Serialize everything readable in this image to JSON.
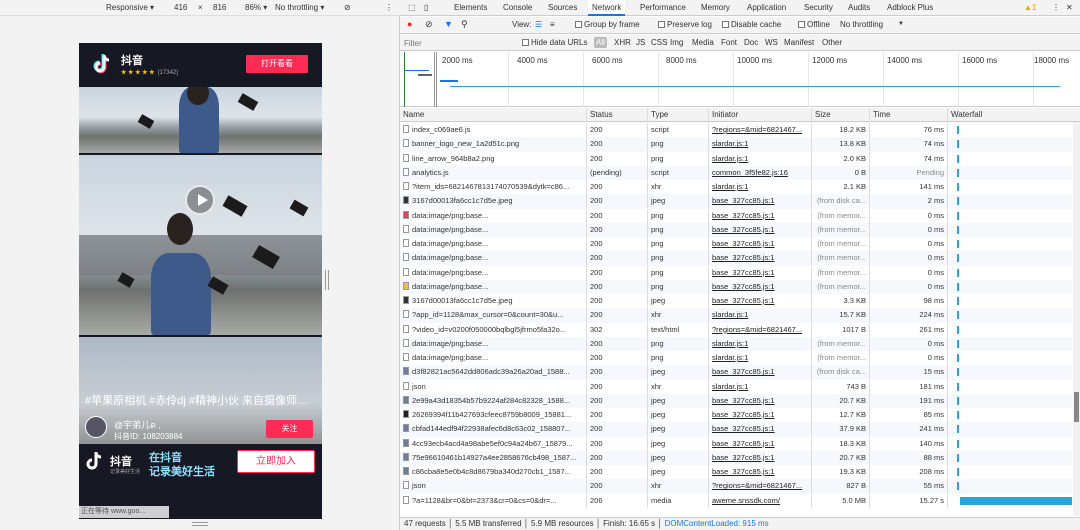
{
  "device_bar": {
    "device": "Responsive ▾",
    "width": "416",
    "x": "×",
    "height": "816",
    "zoom": "86% ▾",
    "throttle": "No throttling ▾",
    "more": "⋮"
  },
  "phone": {
    "app_name": "抖音",
    "rating_stars": "★ ★ ★ ★ ★",
    "rating_count": "(17342)",
    "open_button": "打开看看",
    "caption": "#苹果原相机 #赤伶dj #精神小伙 来自摄像师…",
    "username": "@宇弟儿ด ,",
    "user_id": "抖音ID: 108203884",
    "follow_button": "关注",
    "banner_name": "抖音",
    "banner_sub": "记录美好生活",
    "banner_slogan_1": "在抖音",
    "banner_slogan_2": "记录美好生活",
    "join_button": "立即加入",
    "status_text": "正在等待 www.goo..."
  },
  "devtools": {
    "tabs": [
      "Elements",
      "Console",
      "Sources",
      "Network",
      "Performance",
      "Memory",
      "Application",
      "Security",
      "Audits",
      "Adblock Plus"
    ],
    "active_tab": "Network",
    "warning_count": "▲1",
    "more": "⋮",
    "close": "✕",
    "toolbar": {
      "view_label": "View:",
      "group_by_frame": "Group by frame",
      "preserve_log": "Preserve log",
      "disable_cache": "Disable cache",
      "offline": "Offline",
      "throttling": "No throttling",
      "throttling_arrow": "▼"
    },
    "filter": {
      "placeholder": "Filter",
      "hide_data_urls": "Hide data URLs",
      "types": [
        "All",
        "XHR",
        "JS",
        "CSS",
        "Img",
        "Media",
        "Font",
        "Doc",
        "WS",
        "Manifest",
        "Other"
      ]
    },
    "overview_ticks": [
      "2000 ms",
      "4000 ms",
      "6000 ms",
      "8000 ms",
      "10000 ms",
      "12000 ms",
      "14000 ms",
      "16000 ms",
      "18000 ms"
    ],
    "columns": [
      "Name",
      "Status",
      "Type",
      "Initiator",
      "Size",
      "Time",
      "Waterfall"
    ],
    "rows": [
      {
        "name": "index_c069ae6.js",
        "status": "200",
        "type": "script",
        "initiator": "?regions=&mid=6821467...",
        "size": "18.2 KB",
        "time": "76 ms",
        "icon": "#fff"
      },
      {
        "name": "banner_logo_new_1a2d51c.png",
        "status": "200",
        "type": "png",
        "initiator": "slardar.js:1",
        "size": "13.8 KB",
        "time": "74 ms",
        "icon": "#fff"
      },
      {
        "name": "line_arrow_964b8a2.png",
        "status": "200",
        "type": "png",
        "initiator": "slardar.js:1",
        "size": "2.0 KB",
        "time": "74 ms",
        "icon": "#fff"
      },
      {
        "name": "analytics.js",
        "status": "(pending)",
        "type": "script",
        "initiator": "common_3f5fe82.js:16",
        "size": "0 B",
        "time": "Pending",
        "icon": "#fff"
      },
      {
        "name": "?item_ids=6821467813174070539&dytk=c86...",
        "status": "200",
        "type": "xhr",
        "initiator": "slardar.js:1",
        "size": "2.1 KB",
        "time": "141 ms",
        "icon": "#fff"
      },
      {
        "name": "3167d00013fa6cc1c7d5e.jpeg",
        "status": "200",
        "type": "jpeg",
        "initiator": "base_327cc85.js:1",
        "size": "(from disk ca...",
        "time": "2 ms",
        "icon": "#333"
      },
      {
        "name": "data:image/png;base...",
        "status": "200",
        "type": "png",
        "initiator": "base_327cc85.js:1",
        "size": "(from memor...",
        "time": "0 ms",
        "icon": "#e0445a"
      },
      {
        "name": "data:image/png;base...",
        "status": "200",
        "type": "png",
        "initiator": "base_327cc85.js:1",
        "size": "(from memor...",
        "time": "0 ms",
        "icon": "#fff"
      },
      {
        "name": "data:image/png;base...",
        "status": "200",
        "type": "png",
        "initiator": "base_327cc85.js:1",
        "size": "(from memor...",
        "time": "0 ms",
        "icon": "#fff"
      },
      {
        "name": "data:image/png;base...",
        "status": "200",
        "type": "png",
        "initiator": "base_327cc85.js:1",
        "size": "(from memor...",
        "time": "0 ms",
        "icon": "#fff"
      },
      {
        "name": "data:image/png;base...",
        "status": "200",
        "type": "png",
        "initiator": "base_327cc85.js:1",
        "size": "(from memor...",
        "time": "0 ms",
        "icon": "#fff"
      },
      {
        "name": "data:image/png;base...",
        "status": "200",
        "type": "png",
        "initiator": "base_327cc85.js:1",
        "size": "(from memor...",
        "time": "0 ms",
        "icon": "#f0c040"
      },
      {
        "name": "3167d00013fa6cc1c7d5e.jpeg",
        "status": "200",
        "type": "jpeg",
        "initiator": "base_327cc85.js:1",
        "size": "3.3 KB",
        "time": "98 ms",
        "icon": "#333"
      },
      {
        "name": "?app_id=1128&max_cursor=0&count=30&u...",
        "status": "200",
        "type": "xhr",
        "initiator": "slardar.js:1",
        "size": "15.7 KB",
        "time": "224 ms",
        "icon": "#fff"
      },
      {
        "name": "?video_id=v0200f050000bqlbgl5jfrmo5fa32o...",
        "status": "302",
        "type": "text/html",
        "initiator": "?regions=&mid=6821467...",
        "size": "1017 B",
        "time": "261 ms",
        "icon": "#fff"
      },
      {
        "name": "data:image/png;base...",
        "status": "200",
        "type": "png",
        "initiator": "slardar.js:1",
        "size": "(from memor...",
        "time": "0 ms",
        "icon": "#fff"
      },
      {
        "name": "data:image/png;base...",
        "status": "200",
        "type": "png",
        "initiator": "slardar.js:1",
        "size": "(from memor...",
        "time": "0 ms",
        "icon": "#fff"
      },
      {
        "name": "d3f82821ac5642dd806adc39a26a20ad_1588...",
        "status": "200",
        "type": "jpeg",
        "initiator": "base_327cc85.js:1",
        "size": "(from disk ca...",
        "time": "15 ms",
        "icon": "#6a7fa0"
      },
      {
        "name": "json",
        "status": "200",
        "type": "xhr",
        "initiator": "slardar.js:1",
        "size": "743 B",
        "time": "181 ms",
        "icon": "#fff"
      },
      {
        "name": "2e99a43d18354b57b9224af284c82328_1588...",
        "status": "200",
        "type": "jpeg",
        "initiator": "base_327cc85.js:1",
        "size": "20.7 KB",
        "time": "191 ms",
        "icon": "#6a7fa0"
      },
      {
        "name": "26269394f11b427693cfeec8759b8009_15881...",
        "status": "200",
        "type": "jpeg",
        "initiator": "base_327cc85.js:1",
        "size": "12.7 KB",
        "time": "85 ms",
        "icon": "#222"
      },
      {
        "name": "cbfad144edf94f22938afec6d8c63c02_158807...",
        "status": "200",
        "type": "jpeg",
        "initiator": "base_327cc85.js:1",
        "size": "37.9 KB",
        "time": "241 ms",
        "icon": "#6a7fa0"
      },
      {
        "name": "4cc93ecb4acd4a98abe5ef0c94a24b67_15879...",
        "status": "200",
        "type": "jpeg",
        "initiator": "base_327cc85.js:1",
        "size": "18.3 KB",
        "time": "140 ms",
        "icon": "#6a7fa0"
      },
      {
        "name": "75e96610461b14927a4ee2858676cb498_1587...",
        "status": "200",
        "type": "jpeg",
        "initiator": "base_327cc85.js:1",
        "size": "20.7 KB",
        "time": "88 ms",
        "icon": "#6a7fa0"
      },
      {
        "name": "c86cba8e5e0b4c8d8679ba340d270cb1_1587...",
        "status": "200",
        "type": "jpeg",
        "initiator": "base_327cc85.js:1",
        "size": "19.3 KB",
        "time": "208 ms",
        "icon": "#6a7fa0"
      },
      {
        "name": "json",
        "status": "200",
        "type": "xhr",
        "initiator": "?regions=&mid=6821467...",
        "size": "827 B",
        "time": "55 ms",
        "icon": "#fff"
      },
      {
        "name": "?a=1128&br=0&bt=2373&cr=0&cs=0&dr=...",
        "status": "206",
        "type": "media",
        "initiator": "aweme.snssdk.com/",
        "size": "5.0 MB",
        "time": "15.27 s",
        "icon": "#fff"
      }
    ],
    "summary": {
      "requests": "47 requests",
      "transferred": "5.5 MB transferred",
      "resources": "5.9 MB resources",
      "finish": "Finish: 16.65 s",
      "dcl": "DOMContentLoaded: 915 ms"
    }
  },
  "colors": {
    "accent": "#1a73e8",
    "brand_red": "#fe2c55",
    "record": "#d93025"
  }
}
